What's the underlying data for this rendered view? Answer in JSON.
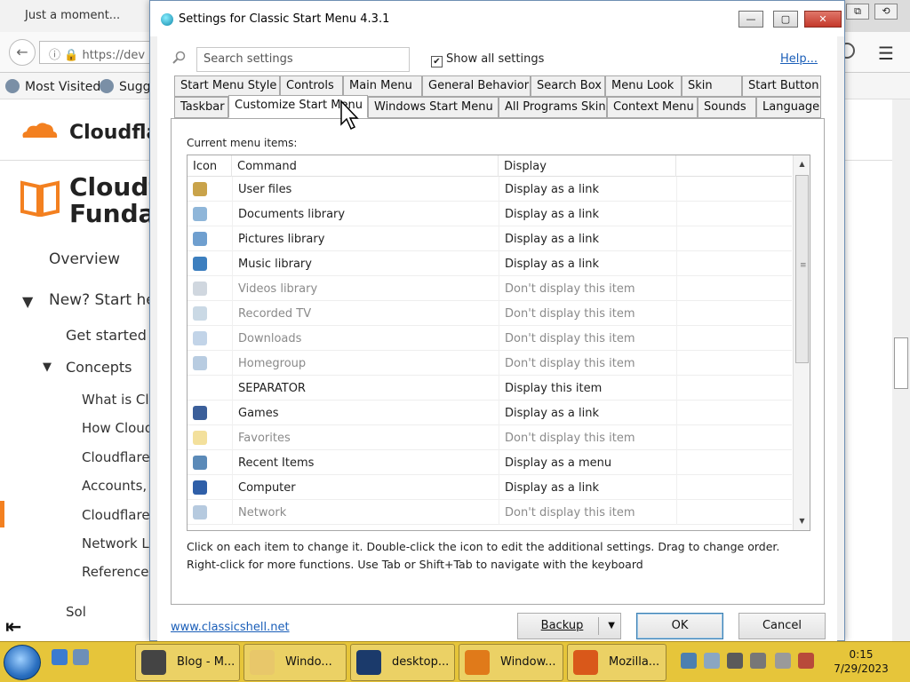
{
  "browser": {
    "tab_title": "Just a moment...",
    "url_text": "https://dev",
    "bookmarks": [
      "Most Visited",
      "Sugg"
    ],
    "brand_text": "Cloudflar",
    "page_title_line1": "Cloudf",
    "page_title_line2": "Fundar",
    "nav_items": [
      "Overview",
      "New? Start he",
      "Get started g",
      "Concepts",
      "What is Clo",
      "How Cloud",
      "Cloudflare",
      "Accounts, z",
      "Cloudflare",
      "Network La",
      "Reference a",
      "Sol"
    ],
    "nav_toggles": [
      "▼",
      "▼"
    ],
    "win_buttons": [
      "⧉",
      "⟲",
      "⤢"
    ],
    "accent_color": "#f38020"
  },
  "dialog": {
    "title": "Settings for Classic Start Menu 4.3.1",
    "title_buttons": [
      "—",
      "▢",
      "✕"
    ],
    "search_placeholder": "Search settings",
    "show_all_label": "Show all settings",
    "show_all_checked": true,
    "help_label": "Help...",
    "tabs_row1": [
      "Start Menu Style",
      "Controls",
      "Main Menu",
      "General Behavior",
      "Search Box",
      "Menu Look",
      "Skin",
      "Start Button"
    ],
    "tabs_row2": [
      "Taskbar",
      "Customize Start Menu",
      "Windows Start Menu",
      "All Programs Skin",
      "Context Menu",
      "Sounds",
      "Language"
    ],
    "active_tab": "Customize Start Menu",
    "current_items_label": "Current menu items:",
    "columns": [
      "Icon",
      "Command",
      "Display"
    ],
    "items": [
      {
        "command": "User files",
        "display": "Display as a link",
        "enabled": true,
        "icon": "user-files-icon",
        "color": "#c9a34a"
      },
      {
        "command": "Documents library",
        "display": "Display as a link",
        "enabled": true,
        "icon": "documents-icon",
        "color": "#8fb6d9"
      },
      {
        "command": "Pictures library",
        "display": "Display as a link",
        "enabled": true,
        "icon": "pictures-icon",
        "color": "#6f9fcf"
      },
      {
        "command": "Music library",
        "display": "Display as a link",
        "enabled": true,
        "icon": "music-icon",
        "color": "#3d7fbf"
      },
      {
        "command": "Videos library",
        "display": "Don't display this item",
        "enabled": false,
        "icon": "videos-icon",
        "color": "#a9b6c4"
      },
      {
        "command": "Recorded TV",
        "display": "Don't display this item",
        "enabled": false,
        "icon": "recorded-tv-icon",
        "color": "#9fb9d0"
      },
      {
        "command": "Downloads",
        "display": "Don't display this item",
        "enabled": false,
        "icon": "downloads-icon",
        "color": "#8fb0d6"
      },
      {
        "command": "Homegroup",
        "display": "Don't display this item",
        "enabled": false,
        "icon": "homegroup-icon",
        "color": "#7ea3c8"
      },
      {
        "command": "SEPARATOR",
        "display": "Display this item",
        "enabled": true,
        "icon": "",
        "color": "#ffffff"
      },
      {
        "command": "Games",
        "display": "Display as a link",
        "enabled": true,
        "icon": "games-icon",
        "color": "#3b5f9a"
      },
      {
        "command": "Favorites",
        "display": "Don't display this item",
        "enabled": false,
        "icon": "favorites-star-icon",
        "color": "#e9c64a"
      },
      {
        "command": "Recent Items",
        "display": "Display as a menu",
        "enabled": true,
        "icon": "recent-items-icon",
        "color": "#5b8ab8"
      },
      {
        "command": "Computer",
        "display": "Display as a link",
        "enabled": true,
        "icon": "computer-icon",
        "color": "#2f5fa8"
      },
      {
        "command": "Network",
        "display": "Don't display this item",
        "enabled": false,
        "icon": "network-icon",
        "color": "#7a9ec4"
      }
    ],
    "hint_line1": "Click on each item to change it. Double-click the icon to edit the additional settings. Drag to change order.",
    "hint_line2": "Right-click for more functions. Use Tab or Shift+Tab to navigate with the keyboard",
    "site_link": "www.classicshell.net",
    "backup_label": "Backup",
    "ok_label": "OK",
    "cancel_label": "Cancel"
  },
  "taskbar": {
    "buttons": [
      {
        "label": "Blog - M...",
        "icon": "raccoon-blog-icon",
        "color": "#444444"
      },
      {
        "label": "Windo...",
        "icon": "explorer-folder-icon",
        "color": "#e8c76a"
      },
      {
        "label": "desktop...",
        "icon": "photoshop-icon",
        "color": "#1b3a6b"
      },
      {
        "label": "Window...",
        "icon": "media-player-icon",
        "color": "#e07a1a"
      },
      {
        "label": "Mozilla...",
        "icon": "firefox-icon",
        "color": "#d9581a"
      }
    ],
    "time": "0:15",
    "date": "7/29/2023",
    "color": "#e6c53a"
  }
}
